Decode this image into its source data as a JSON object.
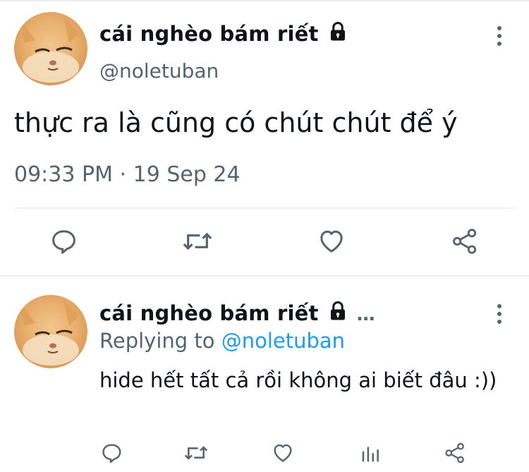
{
  "main_tweet": {
    "display_name": "cái nghèo bám riết",
    "handle": "@noletuban",
    "text": "thực ra là cũng có chút chút để ý",
    "time": "09:33 PM",
    "dot": "·",
    "date": "19 Sep 24",
    "icons": [
      "lock-icon",
      "more-icon",
      "reply-icon",
      "retweet-icon",
      "like-icon",
      "share-icon"
    ]
  },
  "reply_tweet": {
    "display_name": "cái nghèo bám riết",
    "ellipsis": "…",
    "replying_prefix": "Replying to ",
    "replying_to": "@noletuban",
    "text": "hide hết tất cả rồi không ai biết đâu :))",
    "icons": [
      "lock-icon",
      "more-icon",
      "reply-icon",
      "retweet-icon",
      "like-icon",
      "views-icon",
      "share-icon"
    ]
  },
  "colors": {
    "text": "#0f1419",
    "secondary": "#536471",
    "accent": "#1d9bf0",
    "divider": "#eff3f4"
  }
}
